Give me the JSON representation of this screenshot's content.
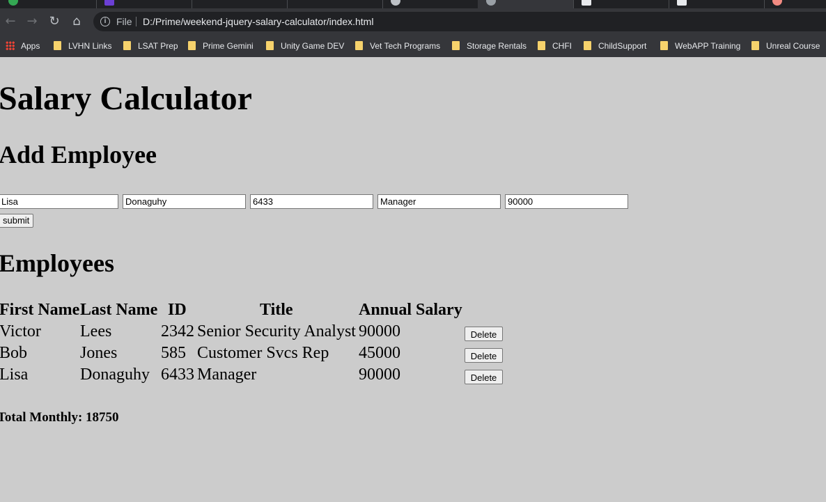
{
  "browser": {
    "address": {
      "scheme_label": "File",
      "url": "D:/Prime/weekend-jquery-salary-calculator/index.html"
    },
    "bookmarks": [
      {
        "label": "Apps",
        "icon": "apps-grid-icon"
      },
      {
        "label": "LVHN Links",
        "icon": "folder-icon"
      },
      {
        "label": "LSAT Prep",
        "icon": "folder-icon"
      },
      {
        "label": "Prime Gemini",
        "icon": "folder-icon"
      },
      {
        "label": "Unity Game DEV",
        "icon": "folder-icon"
      },
      {
        "label": "Vet Tech Programs",
        "icon": "folder-icon"
      },
      {
        "label": "Storage Rentals",
        "icon": "folder-icon"
      },
      {
        "label": "CHFI",
        "icon": "folder-icon"
      },
      {
        "label": "ChildSupport",
        "icon": "folder-icon"
      },
      {
        "label": "WebAPP Training",
        "icon": "folder-icon"
      },
      {
        "label": "Unreal Course",
        "icon": "folder-icon"
      }
    ],
    "colors": {
      "chrome_dark": "#202124",
      "toolbar": "#35363a",
      "folder": "#f6d26c",
      "page_background": "#cccccc"
    }
  },
  "page": {
    "title": "Salary Calculator",
    "add_heading": "Add Employee",
    "inputs": {
      "first_name": "Lisa",
      "last_name": "Donaguhy",
      "id": "6433",
      "title": "Manager",
      "salary": "90000"
    },
    "submit_label": "submit",
    "employees_heading": "Employees",
    "table": {
      "headers": [
        "First Name",
        "Last Name",
        "ID",
        "Title",
        "Annual Salary"
      ],
      "rows": [
        {
          "first": "Victor",
          "last": "Lees",
          "id": "2342",
          "title": "Senior Security Analyst",
          "salary": "90000",
          "action": "Delete"
        },
        {
          "first": "Bob",
          "last": "Jones",
          "id": "585",
          "title": "Customer Svcs Rep",
          "salary": "45000",
          "action": "Delete"
        },
        {
          "first": "Lisa",
          "last": "Donaguhy",
          "id": "6433",
          "title": "Manager",
          "salary": "90000",
          "action": "Delete"
        }
      ]
    },
    "total_monthly": "Total Monthly: 18750"
  }
}
